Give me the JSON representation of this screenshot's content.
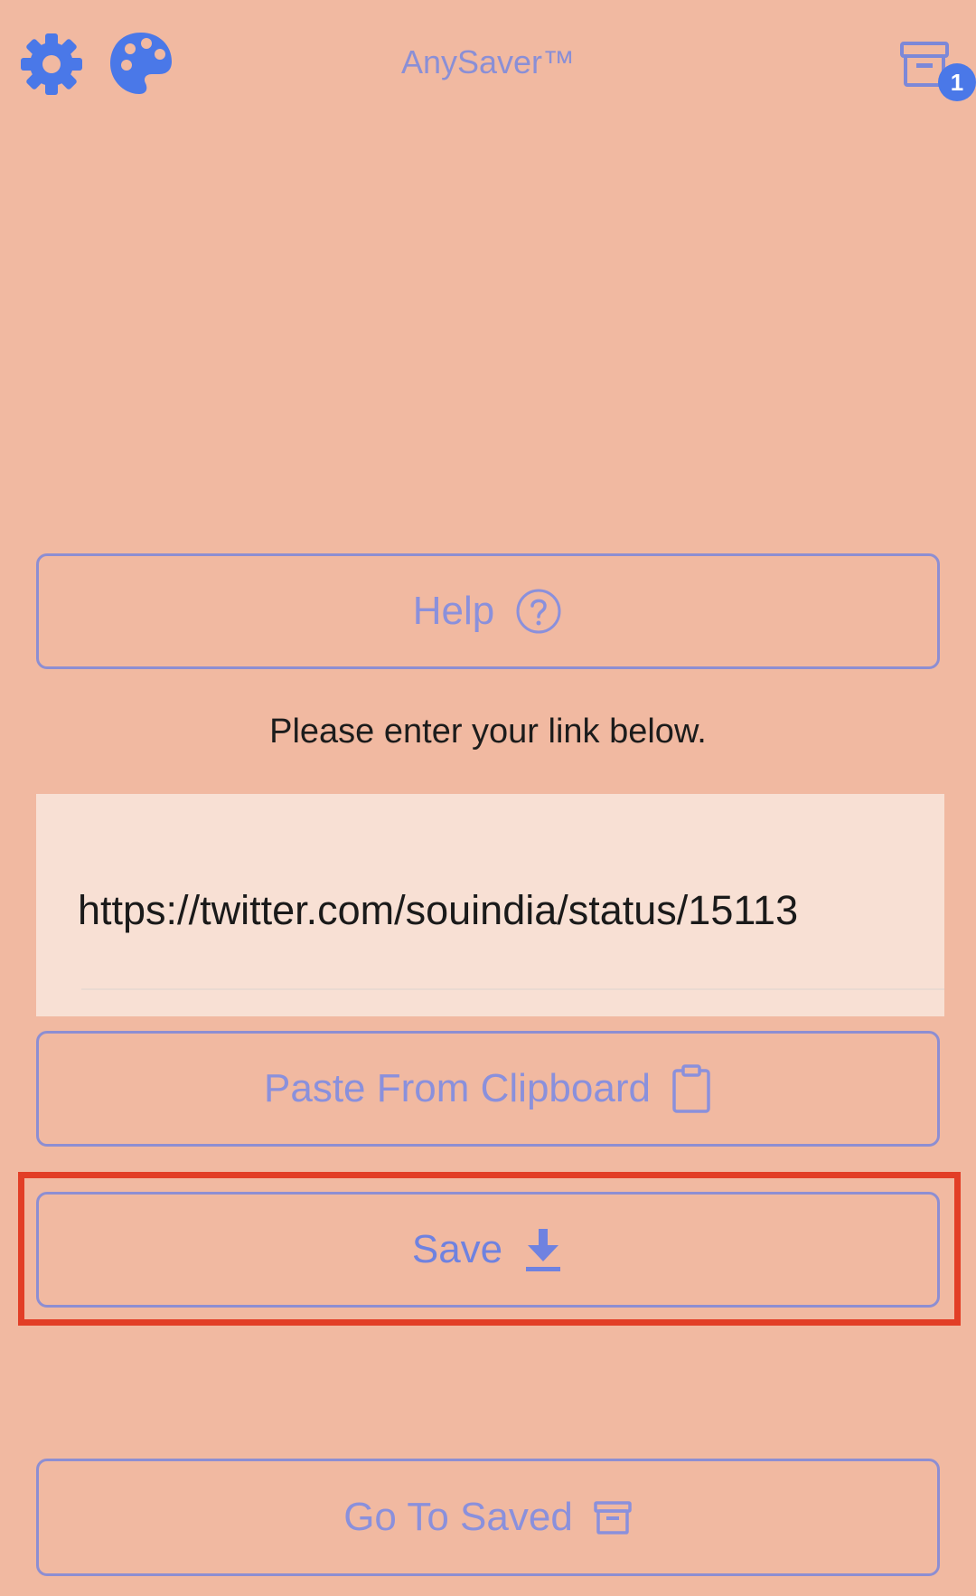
{
  "header": {
    "title": "AnySaver™",
    "settings_icon": "gear-icon",
    "theme_icon": "palette-icon",
    "archive_icon": "archive-box-icon",
    "archive_badge": "1"
  },
  "main": {
    "help_label": "Help",
    "help_icon": "question-circle-icon",
    "prompt": "Please enter your link below.",
    "link_value": "https://twitter.com/souindia/status/15113",
    "paste_label": "Paste From Clipboard",
    "paste_icon": "clipboard-icon",
    "save_label": "Save",
    "save_icon": "download-icon",
    "saved_label": "Go To Saved",
    "saved_icon": "archive-icon"
  },
  "colors": {
    "background": "#f1b9a1",
    "accent": "#4a78e8",
    "button_text": "#8a90dc",
    "highlight": "#e23e26",
    "input_bg": "#f8e0d4"
  }
}
